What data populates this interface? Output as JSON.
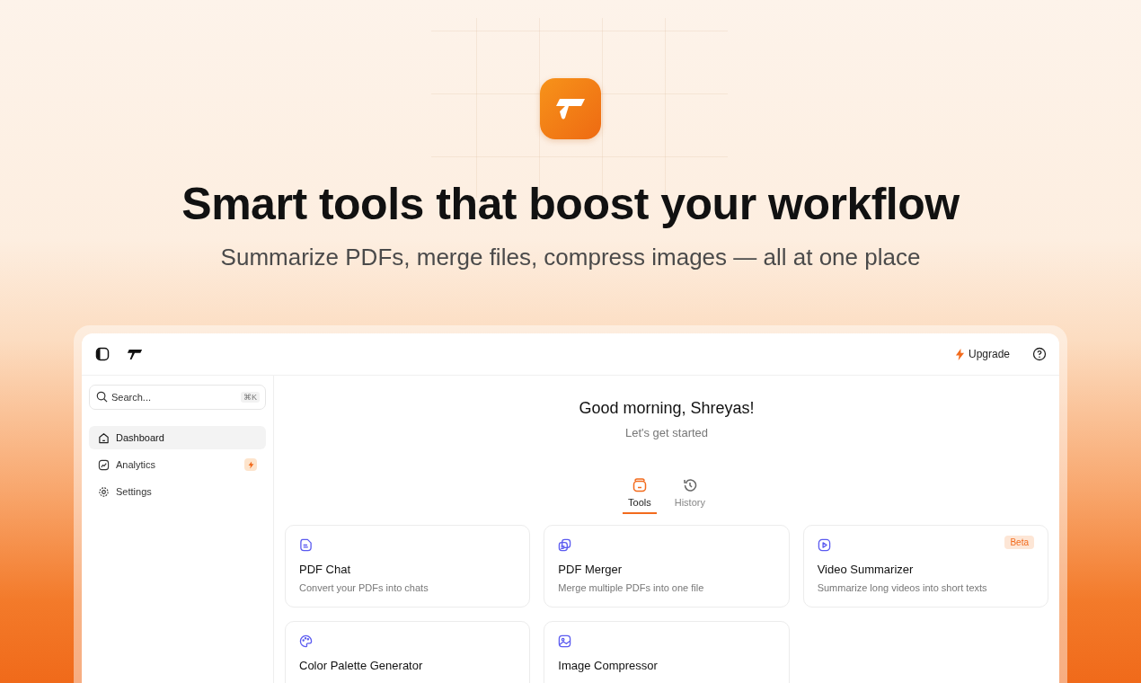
{
  "hero": {
    "headline": "Smart tools that boost your workflow",
    "subtitle": "Summarize PDFs, merge files, compress images — all at one place"
  },
  "topbar": {
    "upgrade": "Upgrade"
  },
  "sidebar": {
    "search": {
      "placeholder": "Search...",
      "shortcut": "⌘K"
    },
    "items": [
      {
        "label": "Dashboard",
        "selected": true,
        "upgrade_badge": false
      },
      {
        "label": "Analytics",
        "selected": false,
        "upgrade_badge": true
      },
      {
        "label": "Settings",
        "selected": false,
        "upgrade_badge": false
      }
    ]
  },
  "main": {
    "greeting": "Good morning, Shreyas!",
    "subtitle": "Let's get started",
    "tabs": [
      {
        "label": "Tools",
        "selected": true
      },
      {
        "label": "History",
        "selected": false
      }
    ],
    "cards": [
      {
        "title": "PDF Chat",
        "description": "Convert your PDFs into chats"
      },
      {
        "title": "PDF Merger",
        "description": "Merge multiple PDFs into one file"
      },
      {
        "title": "Video Summarizer",
        "description": "Summarize long videos into short texts",
        "badge": "Beta"
      },
      {
        "title": "Color Palette Generator"
      },
      {
        "title": "Image Compressor"
      }
    ]
  }
}
